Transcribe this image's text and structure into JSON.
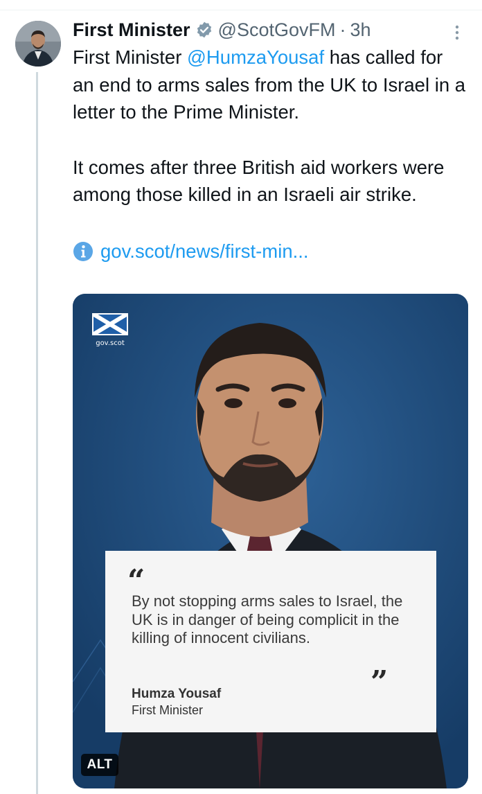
{
  "tweet": {
    "author": {
      "display_name": "First Minister",
      "handle": "@ScotGovFM",
      "separator": "·",
      "time": "3h",
      "verified_icon": "verified-badge-icon"
    },
    "text": {
      "para1_prefix": "First Minister ",
      "mention": "@HumzaYousaf",
      "para1_suffix": " has called for an end to arms sales from the UK to Israel in a letter to the Prime Minister.",
      "para2": "It comes after three British aid workers were among those killed in an Israeli air strike."
    },
    "link": {
      "icon": "info-icon",
      "text": "gov.scot/news/first-min..."
    },
    "media": {
      "logo_label": "gov.scot",
      "quote_open": "“",
      "quote": "By not stopping arms sales to Israel, the UK is in danger of being complicit in the killing of innocent civilians.",
      "quote_close": "”",
      "quote_author": "Humza Yousaf",
      "quote_role": "First Minister",
      "alt_label": "ALT"
    }
  },
  "colors": {
    "link": "#1d9bf0",
    "secondary_text": "#536471",
    "primary_text": "#0f1419",
    "card_background": "#1d4a7a"
  }
}
